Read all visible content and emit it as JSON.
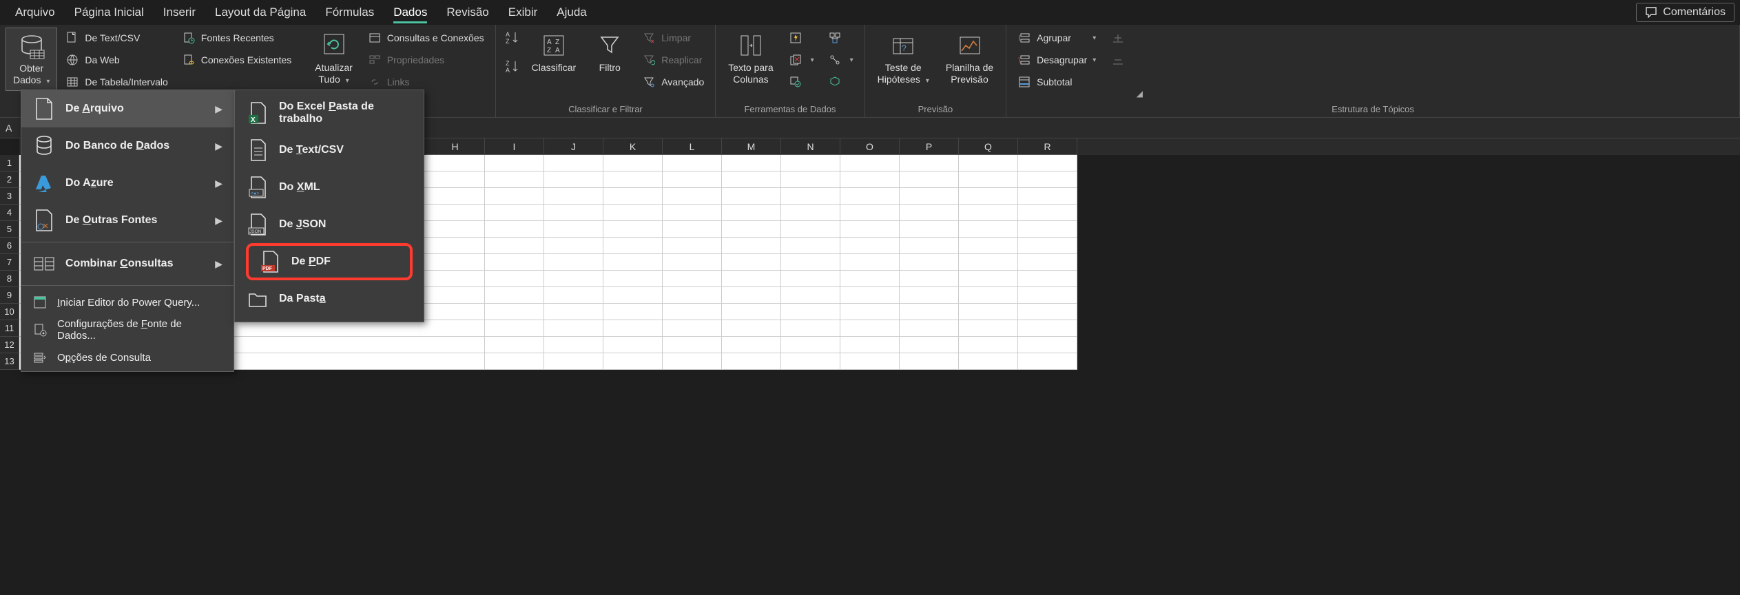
{
  "tabs": {
    "file": "Arquivo",
    "home": "Página Inicial",
    "insert": "Inserir",
    "layout": "Layout da Página",
    "formulas": "Fórmulas",
    "data": "Dados",
    "review": "Revisão",
    "view": "Exibir",
    "help": "Ajuda"
  },
  "comments": "Comentários",
  "ribbon": {
    "get_data": "Obter\nDados",
    "text_csv": "De Text/CSV",
    "from_web": "Da Web",
    "from_table": "De Tabela/Intervalo",
    "recent": "Fontes Recentes",
    "existing": "Conexões Existentes",
    "refresh_all": "Atualizar\nTudo",
    "queries": "Consultas e Conexões",
    "properties": "Propriedades",
    "links": "Links",
    "sort": "Classificar",
    "filter": "Filtro",
    "clear": "Limpar",
    "reapply": "Reaplicar",
    "advanced": "Avançado",
    "text_cols": "Texto para\nColunas",
    "whatif": "Teste de\nHipóteses",
    "forecast": "Planilha de\nPrevisão",
    "group": "Agrupar",
    "ungroup": "Desagrupar",
    "subtotal": "Subtotal",
    "group_sort": "Classificar e Filtrar",
    "group_tools": "Ferramentas de Dados",
    "group_forecast": "Previsão",
    "group_outline": "Estrutura de Tópicos",
    "connections_tail": "xões"
  },
  "name_box": "A",
  "columns": [
    "H",
    "I",
    "J",
    "K",
    "L",
    "M",
    "N",
    "O",
    "P",
    "Q",
    "R"
  ],
  "rows": [
    "1",
    "2",
    "3",
    "4",
    "5",
    "6",
    "7",
    "8",
    "9",
    "10",
    "11",
    "12",
    "13"
  ],
  "menu1": {
    "from_file": "De Arquivo",
    "from_db": "Do Banco de Dados",
    "from_azure": "Do Azure",
    "other": "De Outras Fontes",
    "combine": "Combinar Consultas",
    "pq_editor": "Iniciar Editor do Power Query...",
    "ds_settings": "Configurações de Fonte de Dados...",
    "query_opts": "Opções de Consulta"
  },
  "menu2": {
    "excel": "Do Excel Pasta de trabalho",
    "textcsv": "De Text/CSV",
    "xml": "Do XML",
    "json": "De JSON",
    "pdf": "De PDF",
    "folder": "Da Pasta"
  }
}
